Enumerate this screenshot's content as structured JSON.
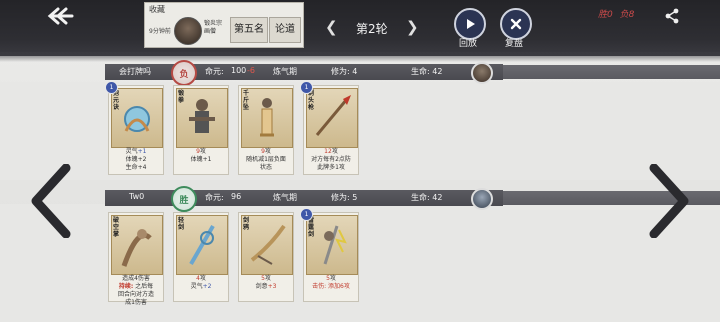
{
  "header": {
    "card_label": "收藏",
    "time_ago": "9分钟前",
    "avatar_name": "锻炎宗 画僧",
    "rank": "第五名",
    "discuss": "论道",
    "round": "第2轮",
    "replay": "回放",
    "review": "复盘",
    "score_win": "胜0",
    "score_lose": "负8"
  },
  "players": [
    {
      "name": "会打牌吗",
      "result": "负",
      "mingyuan_label": "命元:",
      "mingyuan_value": "100",
      "mingyuan_delta": "-6",
      "stage": "炼气期",
      "cultivation": "修为: 4",
      "hp": "生命: 42",
      "cards": [
        {
          "title": "抱元诀",
          "level": "1",
          "lines": [
            {
              "t": "灵气",
              "v": "+1",
              "c": "blue"
            },
            {
              "t": "体魄+2"
            },
            {
              "t": "生命+4"
            }
          ]
        },
        {
          "title": "锻拳",
          "level": "",
          "lines": [
            {
              "t": "9",
              "c": "red",
              "s": "攻"
            },
            {
              "t": "体魄+1"
            }
          ]
        },
        {
          "title": "千斤坠",
          "level": "",
          "lines": [
            {
              "t": "9",
              "c": "red",
              "s": "攻"
            },
            {
              "t": "随机减1层负面"
            },
            {
              "t": "状态"
            }
          ]
        },
        {
          "title": "剃头枪",
          "level": "1",
          "lines": [
            {
              "t": "12",
              "c": "red",
              "s": "攻"
            },
            {
              "t": "对方每有2点防"
            },
            {
              "t": "此牌多1攻"
            }
          ]
        }
      ]
    },
    {
      "name": "Tw0",
      "result": "胜",
      "mingyuan_label": "命元:",
      "mingyuan_value": "96",
      "mingyuan_delta": "",
      "stage": "炼气期",
      "cultivation": "修为: 5",
      "hp": "生命: 42",
      "cards": [
        {
          "title": "破空掌",
          "level": "",
          "lines": [
            {
              "t": "造成4伤害"
            },
            {
              "t": "持续:",
              "k": true,
              "s": " 之后每"
            },
            {
              "t": "回合向对方造"
            },
            {
              "t": "成1伤害"
            }
          ]
        },
        {
          "title": "轻剑",
          "level": "",
          "lines": [
            {
              "t": "4",
              "c": "red",
              "s": "攻"
            },
            {
              "t": "灵气",
              "v": "+2",
              "c": "blue"
            }
          ]
        },
        {
          "title": "剑鸦",
          "level": "",
          "lines": [
            {
              "t": "5",
              "c": "red",
              "s": "攻"
            },
            {
              "t": "剑意",
              "v": "+3",
              "c": "red"
            }
          ]
        },
        {
          "title": "雷霆剑",
          "level": "1",
          "lines": [
            {
              "t": "5",
              "c": "red",
              "s": "攻"
            },
            {
              "t": "击伤: 添加6攻",
              "c": "red"
            }
          ]
        }
      ]
    }
  ]
}
